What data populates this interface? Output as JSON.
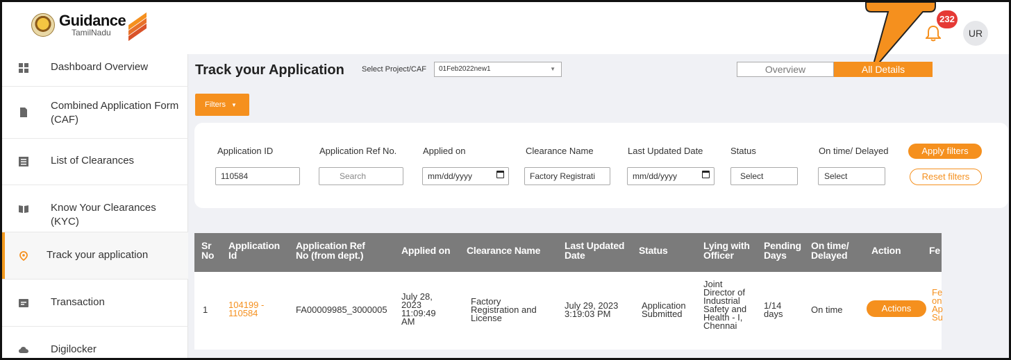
{
  "brand": {
    "name": "Guidance",
    "sub": "TamilNadu"
  },
  "header": {
    "notification_count": "232",
    "user_initials": "UR"
  },
  "colors": {
    "accent": "#f5901e",
    "header_gray": "#7b7b7b",
    "badge_red": "#e53935"
  },
  "sidebar": {
    "items": [
      {
        "label": "Dashboard Overview",
        "icon": "grid-icon"
      },
      {
        "label": "Combined Application Form (CAF)",
        "icon": "document-icon"
      },
      {
        "label": "List of Clearances",
        "icon": "list-icon"
      },
      {
        "label": "Know Your Clearances (KYC)",
        "icon": "book-icon"
      },
      {
        "label": "Track your application",
        "icon": "location-pin-icon",
        "active": true
      },
      {
        "label": "Transaction",
        "icon": "transaction-icon"
      },
      {
        "label": "Digilocker",
        "icon": "cloud-icon"
      }
    ]
  },
  "main": {
    "title": "Track your Application",
    "project_label": "Select Project/CAF",
    "project_value": "01Feb2022new1",
    "view_tabs": {
      "overview": "Overview",
      "all_details": "All Details"
    },
    "filters_button": "Filters"
  },
  "filters": {
    "application_id": {
      "label": "Application ID",
      "value": "110584"
    },
    "application_ref": {
      "label": "Application Ref No.",
      "placeholder": "Search"
    },
    "applied_on": {
      "label": "Applied on",
      "placeholder": "mm/dd/yyyy"
    },
    "clearance_name": {
      "label": "Clearance Name",
      "value": "Factory Registrati"
    },
    "last_updated": {
      "label": "Last Updated Date",
      "placeholder": "mm/dd/yyyy"
    },
    "status": {
      "label": "Status",
      "value": "Select"
    },
    "on_time": {
      "label": "On time/ Delayed",
      "value": "Select"
    },
    "apply_label": "Apply filters",
    "reset_label": "Reset filters"
  },
  "table": {
    "headers": {
      "sr_no": [
        "Sr",
        "No"
      ],
      "app_id": [
        "Application",
        "Id"
      ],
      "app_ref": [
        "Application Ref",
        "No (from dept.)"
      ],
      "applied_on": "Applied on",
      "clearance_name": "Clearance Name",
      "last_updated": [
        "Last Updated",
        "Date"
      ],
      "status": "Status",
      "lying_with": [
        "Lying with",
        "Officer"
      ],
      "pending_days": [
        "Pending",
        "Days"
      ],
      "on_time": [
        "On time/",
        "Delayed"
      ],
      "action": "Action",
      "fee": "Fe"
    },
    "rows": [
      {
        "sr": "1",
        "app_id": [
          "104199 -",
          "110584"
        ],
        "app_ref": "FA00009985_3000005",
        "applied_on": [
          "July 28,",
          "2023",
          "11:09:49",
          "AM"
        ],
        "clearance_name": [
          "Factory",
          "Registration and",
          "License"
        ],
        "last_updated": [
          "July 29, 2023",
          "3:19:03 PM"
        ],
        "status": [
          "Application",
          "Submitted"
        ],
        "lying_with": [
          "Joint",
          "Director of",
          "Industrial",
          "Safety and",
          "Health - I,",
          "Chennai"
        ],
        "pending_days": [
          "1/14",
          "days"
        ],
        "on_time": "On time",
        "action_label": "Actions",
        "fee": [
          "Fe",
          "on",
          "Ap",
          "Su"
        ]
      }
    ]
  }
}
